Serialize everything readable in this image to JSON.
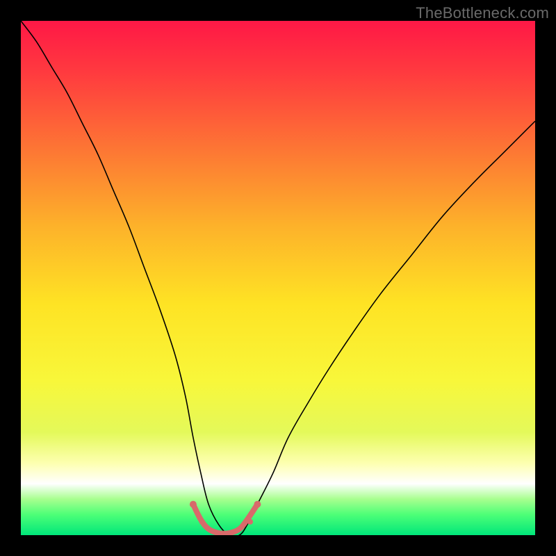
{
  "watermark": "TheBottleneck.com",
  "chart_data": {
    "type": "line",
    "title": "",
    "xlabel": "",
    "ylabel": "",
    "xlim": [
      0,
      100
    ],
    "ylim": [
      0,
      100
    ],
    "grid": false,
    "legend": false,
    "background": {
      "type": "vertical-gradient",
      "stops": [
        {
          "offset": 0.0,
          "color": "#ff1846"
        },
        {
          "offset": 0.1,
          "color": "#ff3a3f"
        },
        {
          "offset": 0.25,
          "color": "#fd7634"
        },
        {
          "offset": 0.4,
          "color": "#fdb22a"
        },
        {
          "offset": 0.55,
          "color": "#fee324"
        },
        {
          "offset": 0.7,
          "color": "#f8f73a"
        },
        {
          "offset": 0.8,
          "color": "#e4f95a"
        },
        {
          "offset": 0.86,
          "color": "#fdffb0"
        },
        {
          "offset": 0.9,
          "color": "#ffffff"
        },
        {
          "offset": 0.93,
          "color": "#a7ff8f"
        },
        {
          "offset": 0.96,
          "color": "#4dff77"
        },
        {
          "offset": 1.0,
          "color": "#00e67a"
        }
      ]
    },
    "series": [
      {
        "name": "bottleneck-curve",
        "stroke": "#000000",
        "stroke_width": 1.6,
        "x": [
          0,
          3,
          6,
          9,
          12,
          15,
          18,
          21,
          24,
          27,
          30,
          32,
          33.5,
          35,
          36.5,
          38.5,
          40.5,
          42.5,
          44,
          46,
          49,
          52,
          56,
          60,
          65,
          70,
          76,
          82,
          88,
          94,
          100
        ],
        "y": [
          100,
          96,
          91,
          86,
          80,
          74,
          67,
          60,
          52,
          44,
          35,
          27,
          19,
          12,
          6,
          2,
          0,
          0,
          2,
          6,
          12,
          19,
          26,
          32.5,
          40,
          47,
          54.5,
          62,
          68.5,
          74.5,
          80.5
        ]
      },
      {
        "name": "highlight-floor",
        "stroke": "#d86a6a",
        "stroke_width": 8,
        "linecap": "round",
        "x": [
          33.5,
          35,
          36.5,
          38.5,
          40.5,
          42.5,
          44,
          46
        ],
        "y": [
          6,
          3,
          1.2,
          0.4,
          0.4,
          1.2,
          3,
          6
        ]
      }
    ],
    "markers": [
      {
        "x": 33.5,
        "y": 6.0,
        "r": 5,
        "color": "#d86a6a"
      },
      {
        "x": 46.0,
        "y": 6.0,
        "r": 5,
        "color": "#d86a6a"
      },
      {
        "x": 35.2,
        "y": 2.6,
        "r": 4,
        "color": "#d86a6a"
      },
      {
        "x": 44.6,
        "y": 2.6,
        "r": 4,
        "color": "#d86a6a"
      }
    ]
  }
}
